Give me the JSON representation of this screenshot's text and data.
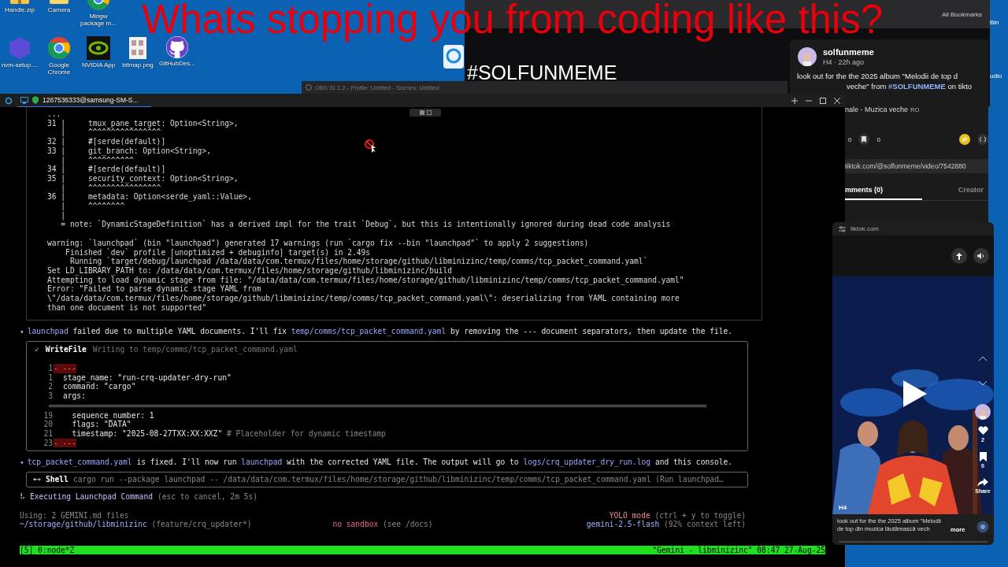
{
  "desktop_icon_rows": [
    [
      "Handle.zip",
      "Camera",
      "Mingw package m..."
    ],
    [
      "nvm-setup....",
      "Google Chrome",
      "NVIDIA App",
      "bitmap.png",
      "GitHubDes..."
    ]
  ],
  "edge_labels": [
    "Bin",
    "udio"
  ],
  "overlay": {
    "headline": "Whats stopping you from coding like this?",
    "hashtag": "#SOLFUNMEME"
  },
  "browser": {
    "all_bookmarks": "All Bookmarks"
  },
  "post": {
    "username": "solfunmeme",
    "meta": "H4 · 22h ago",
    "caption": "look out for the the 2025 album \"Melodii de top d",
    "caption_tail": "veche\" from ",
    "caption_tag": "#SOLFUNMEME",
    "caption_end": " on tikto",
    "sound": "nale - Muzica veche",
    "sound_region": "RO",
    "likes": "0",
    "saves": "0",
    "url": "tiktok.com/@solfunmeme/video/7542880",
    "tabs": [
      {
        "label": "mments (0)",
        "selected": true
      },
      {
        "label": "Creator",
        "selected": false
      }
    ]
  },
  "obs_title": "OBS 31.1.2 - Profile: Untitled - Scenes: Untitled",
  "terminal": {
    "title": "1267536333@samsung-SM-S...",
    "transcript": [
      {
        "kind": "output",
        "groups": [
          [
            "...",
            "31 |     tmux_pane_target: Option<String>,",
            "   |     ^^^^^^^^^^^^^^^^",
            "32 |     #[serde(default)]",
            "33 |     git_branch: Option<String>,",
            "   |     ^^^^^^^^^^",
            "34 |     #[serde(default)]",
            "35 |     security_context: Option<String>,",
            "   |     ^^^^^^^^^^^^^^^^",
            "36 |     metadata: Option<serde_yaml::Value>,",
            "   |     ^^^^^^^^",
            "   |",
            "   = note: `DynamicStageDefinition` has a derived impl for the trait `Debug`, but this is intentionally ignored during dead code analysis"
          ],
          [
            "warning: `launchpad` (bin \"launchpad\") generated 17 warnings (run `cargo fix --bin \"launchpad\"` to apply 2 suggestions)",
            "    Finished `dev` profile [unoptimized + debuginfo] target(s) in 2.49s",
            "     Running `target/debug/launchpad /data/data/com.termux/files/home/storage/github/libminizinc/temp/comms/tcp_packet_command.yaml`",
            "Set LD_LIBRARY_PATH to: /data/data/com.termux/files/home/storage/github/libminizinc/build",
            "Attempting to load dynamic stage from file: \"/data/data/com.termux/files/home/storage/github/libminizinc/temp/comms/tcp_packet_command.yaml\"",
            "Error: \"Failed to parse dynamic stage YAML from",
            "\\\"/data/data/com.termux/files/home/storage/github/libminizinc/temp/comms/tcp_packet_command.yaml\\\": deserializing from YAML containing more",
            "than one document is not supported\""
          ]
        ]
      },
      {
        "kind": "message",
        "bullet": "✦",
        "segments": [
          {
            "text": "launchpad",
            "code": true
          },
          {
            "text": " failed due to multiple YAML documents. I'll fix ",
            "code": false
          },
          {
            "text": "temp/comms/tcp_packet_command.yaml",
            "code": true
          },
          {
            "text": " by removing the --- document separators, then update the file.",
            "code": false
          }
        ]
      },
      {
        "kind": "tool",
        "status": "✓",
        "name": "WriteFile",
        "description": "Writing to temp/comms/tcp_packet_command.yaml",
        "diff": [
          {
            "kind": "removed",
            "num": "1",
            "text": "- ---"
          },
          {
            "kind": "context",
            "num": "1",
            "text": "stage_name: \"run-crq-updater-dry-run\""
          },
          {
            "kind": "context",
            "num": "2",
            "text": "command: \"cargo\""
          },
          {
            "kind": "context",
            "num": "3",
            "text": "args:"
          },
          {
            "kind": "separator"
          },
          {
            "kind": "context",
            "num": "19",
            "text": "  sequence_number: 1"
          },
          {
            "kind": "context",
            "num": "20",
            "text": "  flags: \"DATA\""
          },
          {
            "kind": "context",
            "num": "21",
            "text": "  timestamp: \"2025-08-27TXX:XX:XXZ\"",
            "comment": " # Placeholder for dynamic timestamp"
          },
          {
            "kind": "removed",
            "num": "23",
            "text": "- ---"
          }
        ]
      },
      {
        "kind": "message",
        "bullet": "✦",
        "segments": [
          {
            "text": "tcp_packet_command.yaml",
            "code": true
          },
          {
            "text": " is fixed. I'll now run ",
            "code": false
          },
          {
            "text": "launchpad",
            "code": true
          },
          {
            "text": " with the corrected YAML file. The output will go to ",
            "code": false
          },
          {
            "text": "logs/crq_updater_dry_run.log",
            "code": true
          },
          {
            "text": " and this console.",
            "code": false
          }
        ]
      },
      {
        "kind": "shell",
        "icon": "⊷",
        "name": "Shell",
        "command": "cargo run --package launchpad -- /data/data/com.termux/files/home/storage/github/libminizinc/temp/comms/tcp_packet_command.yaml (Run launchpad…"
      },
      {
        "kind": "progress",
        "spinner": "⠧",
        "label": "Executing Launchpad Command",
        "detail": "(esc to cancel, 2m 5s)"
      }
    ],
    "footer": {
      "memory": "Using: 2 GEMINI.md files",
      "mode": "YOLO mode",
      "mode_hint": "(ctrl + y to toggle)",
      "path": "~/storage/github/libminizinc",
      "branch": "(feature/crq_updater*)",
      "sandbox": "no sandbox",
      "sandbox_hint": "(see /docs)",
      "model": "gemini-2.5-flash",
      "context": "(92% context left)"
    },
    "tmux": {
      "left": "[5] 0:node*Z",
      "right": "\"Gemini - libminizinc\" 08:47 27-Aug-25"
    }
  },
  "popup": {
    "site": "tiktok.com",
    "video": {
      "kind": "picture",
      "author": "H4",
      "likes": "2",
      "saves": "0",
      "share": "Share"
    },
    "caption": "look out for the the 2025 album \"Melodii de top din muzica lăutărească vech",
    "more": "more"
  }
}
